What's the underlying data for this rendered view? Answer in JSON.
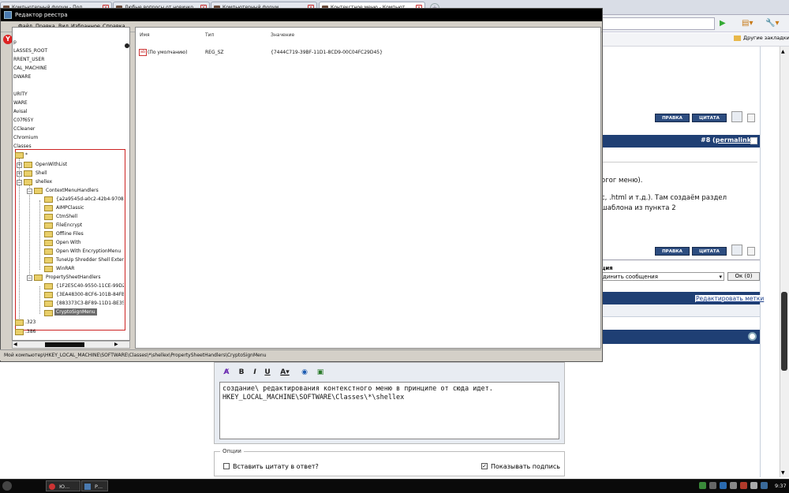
{
  "browser": {
    "tabs": [
      {
        "label": "Компьютерный форум - Под..."
      },
      {
        "label": "Любые вопросы от новичко..."
      },
      {
        "label": "Компьютерный форум"
      },
      {
        "label": "Контекстное меню - Компьют..."
      }
    ],
    "other_bookmarks": "Другие закладки"
  },
  "regedit": {
    "title": "Редактор реестра",
    "menu": [
      "Файл",
      "Правка",
      "Вид",
      "Избранное",
      "Справка"
    ],
    "tree_top": [
      "р",
      "LASSES_ROOT",
      "RRENT_USER",
      "CAL_MACHINE",
      "DWARE",
      "",
      "URITY",
      "WARE",
      "Avisal",
      "C07f65Y",
      "CCleaner",
      "Chromium",
      "Classes"
    ],
    "tree_sub": [
      {
        "label": "*",
        "level": 0
      },
      {
        "label": "OpenWithList",
        "level": 1
      },
      {
        "label": "Shell",
        "level": 1
      },
      {
        "label": "shellex",
        "level": 1
      },
      {
        "label": "ContextMenuHandlers",
        "level": 2
      },
      {
        "label": "{a2a9545d-a0c2-42b4-9708-a0",
        "level": 3
      },
      {
        "label": "AIMPClassic",
        "level": 3
      },
      {
        "label": "CtmShell",
        "level": 3
      },
      {
        "label": "FileEncrypt",
        "level": 3
      },
      {
        "label": "Offline Files",
        "level": 3
      },
      {
        "label": "Open With",
        "level": 3
      },
      {
        "label": "Open With EncryptionMenu",
        "level": 3
      },
      {
        "label": "TuneUp Shredder Shell Exten",
        "level": 3
      },
      {
        "label": "WinRAR",
        "level": 3
      },
      {
        "label": "PropertySheetHandlers",
        "level": 2
      },
      {
        "label": "{1F2E5C40-9550-11CE-99D2-",
        "level": 3
      },
      {
        "label": "{3EA48300-8CF6-101B-84FB-",
        "level": 3
      },
      {
        "label": "{883373C3-BF89-11D1-BE35-",
        "level": 3
      },
      {
        "label": "CryptoSignMenu",
        "level": 3
      }
    ],
    "tree_after": [
      ".323",
      ".386"
    ],
    "columns": {
      "name": "Имя",
      "type": "Тип",
      "value": "Значение"
    },
    "value_row": {
      "name": "(По умолчанию)",
      "type": "REG_SZ",
      "value": "{7444C719-39BF-11D1-8CD9-00C04FC29D45}"
    },
    "status_path": "Мой компьютер\\HKEY_LOCAL_MACHINE\\SOFTWARE\\Classes\\*\\shellex\\PropertySheetHandlers\\CryptoSignMenu"
  },
  "forum": {
    "btn_edit": "ПРАВКА",
    "btn_quote": "ЦИТАТА",
    "post_number": "#8 (",
    "permalink": "permalink",
    "post_number_end": ")",
    "line1": "огог меню).",
    "line2": "с, .html и т.д.). Там создаём раздел",
    "line3": "шаблона из пункта 2",
    "action_label": "ция",
    "select_value": "динить сообщения",
    "ok_button": "Ок (0)",
    "edit_tags": "Редактировать метки",
    "editor_text_1": "создание\\ редактирования контекстного меню в принципе от сюда идет.",
    "editor_text_2": "HKEY_LOCAL_MACHINE\\SOFTWARE\\Classes\\*\\shellex",
    "options_legend": "Опции",
    "opt_quote": "Вставить цитату в ответ?",
    "opt_signature": "Показывать подпись"
  },
  "taskbar": {
    "btn1": "Ю...",
    "btn2": "Р...",
    "clock": "9:37"
  }
}
